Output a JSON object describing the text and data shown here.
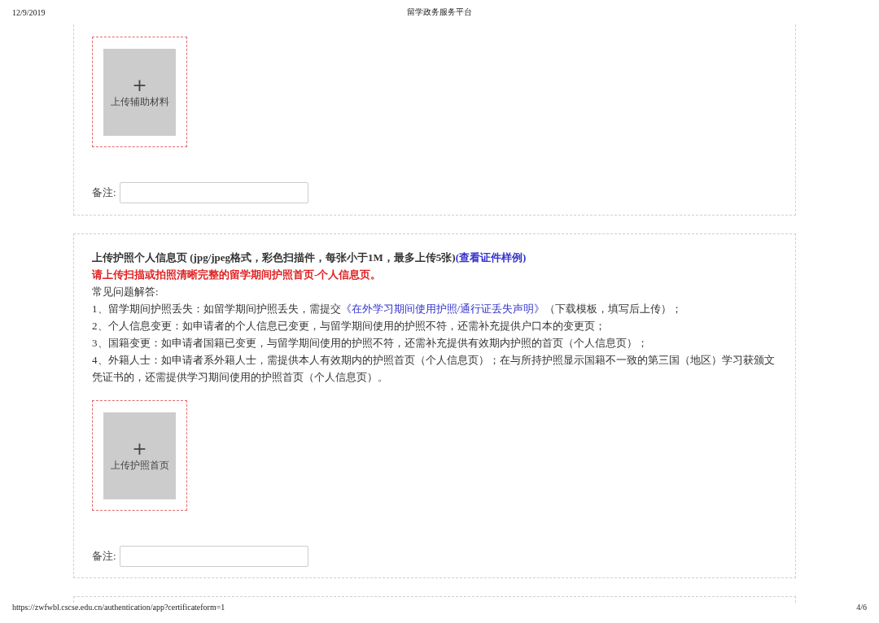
{
  "header": {
    "date": "12/9/2019",
    "title": "留学政务服务平台"
  },
  "sections": [
    {
      "upload": {
        "plus": "+",
        "label": "上传辅助材料"
      },
      "remark": {
        "label": "备注:"
      }
    },
    {
      "title": "上传护照个人信息页 (jpg/jpeg格式，彩色扫描件，每张小于1M，最多上传5张)",
      "sample_link": "(查看证件样例)",
      "warning": "请上传扫描或拍照清晰完整的留学期间护照首页-个人信息页。",
      "faq_title": "常见问题解答:",
      "faq": [
        {
          "segments": [
            {
              "kind": "text",
              "text": "1、留学期间护照丢失：如留学期间护照丢失，需提交"
            },
            {
              "kind": "link",
              "text": "《在外学习期间使用护照/通行证丢失声明》"
            },
            {
              "kind": "text",
              "text": "（下载模板，填写后上传）；"
            }
          ]
        },
        {
          "segments": [
            {
              "kind": "text",
              "text": "2、个人信息变更：如申请者的个人信息已变更，与留学期间使用的护照不符，还需补充提供户口本的变更页；"
            }
          ]
        },
        {
          "segments": [
            {
              "kind": "text",
              "text": "3、国籍变更：如申请者国籍已变更，与留学期间使用的护照不符，还需补充提供有效期内护照的首页（个人信息页）；"
            }
          ]
        },
        {
          "segments": [
            {
              "kind": "text",
              "text": "4、外籍人士：如申请者系外籍人士，需提供本人有效期内的护照首页（个人信息页）；在与所持护照显示国籍不一致的第三国（地区）学习获颁文凭证书的，还需提供学习期间使用的护照首页（个人信息页）。"
            }
          ]
        }
      ],
      "upload": {
        "plus": "+",
        "label": "上传护照首页"
      },
      "remark": {
        "label": "备注:"
      }
    }
  ],
  "footer": {
    "url": "https://zwfwbl.cscse.edu.cn/authentication/app?certificateform=1",
    "page": "4/6"
  }
}
